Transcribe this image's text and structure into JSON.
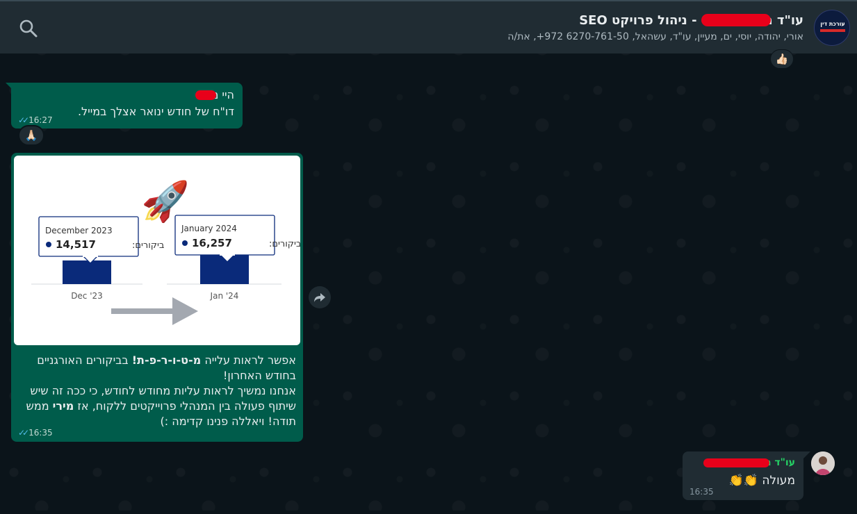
{
  "header": {
    "title_prefix": "עו\"ד מ",
    "title_suffix": "- ניהול פרויקט SEO",
    "participants": "אורי, יהודה, יוסי, ים, מעיין, עו\"ד, עשהאל, 6270-761-50 972+, את/ה",
    "avatar_text": "עורכת דין",
    "search_icon": "search-icon"
  },
  "reaction_top": "👍🏻",
  "message1": {
    "greeting": "היי מ",
    "line2": "דו\"ח של חודש ינואר אצלך במייל.",
    "time": "16:27",
    "reaction": "🙏🏻"
  },
  "message2": {
    "rocket": "🚀",
    "left_card": {
      "month": "December 2023",
      "label": "ביקורים:",
      "value": "14,517",
      "axis": "Dec '23"
    },
    "right_card": {
      "month": "January 2024",
      "label": "ביקורים:",
      "value": "16,257",
      "axis": "Jan '24"
    },
    "text_part1": "אפשר לראות עלייה ",
    "text_bold1": "מ-ט-ו-ר-פ-ת!",
    "text_part2": " בביקורים האורגניים בחודש האחרון!",
    "text_line2": "אנחנו נמשיך לראות עליות מחודש לחודש, כי ככה זה שיש שיתוף פעולה בין המנהלי פרוייקטים ללקוח, אז ",
    "text_bold2": "מירי",
    "text_part3": " ממש תודה! ויאללה פנינו קדימה :)",
    "time": "16:35"
  },
  "message3": {
    "sender_prefix": "עו\"ד מ",
    "text": "מעולה",
    "emoji": "👏👏",
    "time": "16:35"
  },
  "chart_data": {
    "type": "bar",
    "categories": [
      "Dec '23",
      "Jan '24"
    ],
    "series": [
      {
        "values": [
          14517,
          16257
        ]
      }
    ]
  }
}
